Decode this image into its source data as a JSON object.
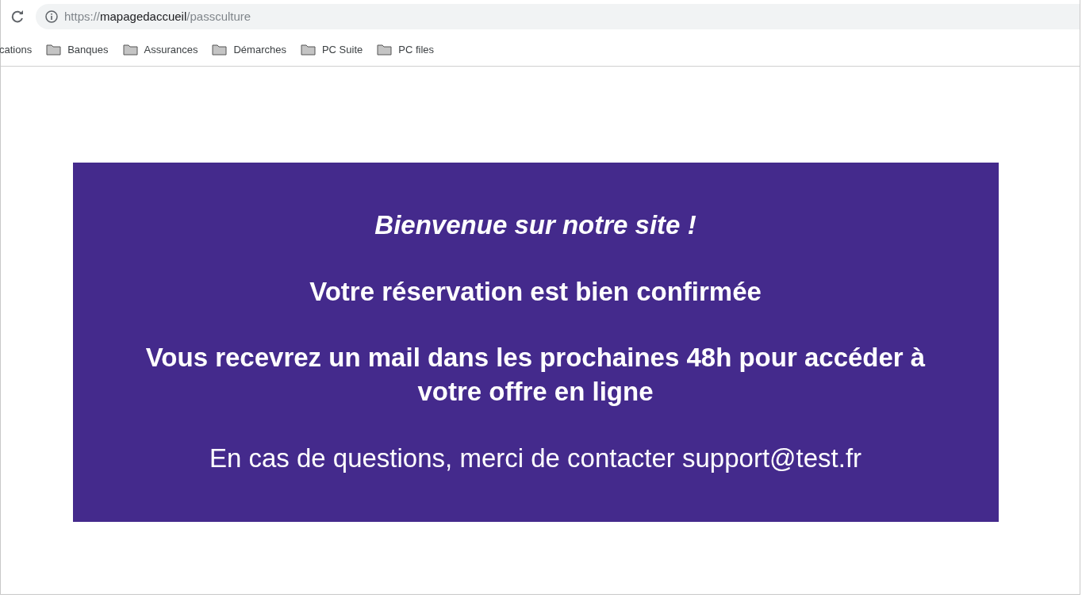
{
  "address_bar": {
    "url_scheme": "https://",
    "url_host": "mapagedaccueil",
    "url_path": "/passculture"
  },
  "bookmarks": [
    {
      "label": "cations",
      "kind": "link"
    },
    {
      "label": "Banques",
      "kind": "folder"
    },
    {
      "label": "Assurances",
      "kind": "folder"
    },
    {
      "label": "Démarches",
      "kind": "folder"
    },
    {
      "label": "PC Suite",
      "kind": "folder"
    },
    {
      "label": "PC files",
      "kind": "folder"
    }
  ],
  "banner": {
    "welcome": "Bienvenue sur notre site !",
    "confirmation": "Votre réservation est bien confirmée",
    "notice": "Vous recevrez un mail dans les prochaines 48h pour accéder à votre offre en ligne",
    "contact": "En cas de questions, merci de contacter support@test.fr"
  }
}
